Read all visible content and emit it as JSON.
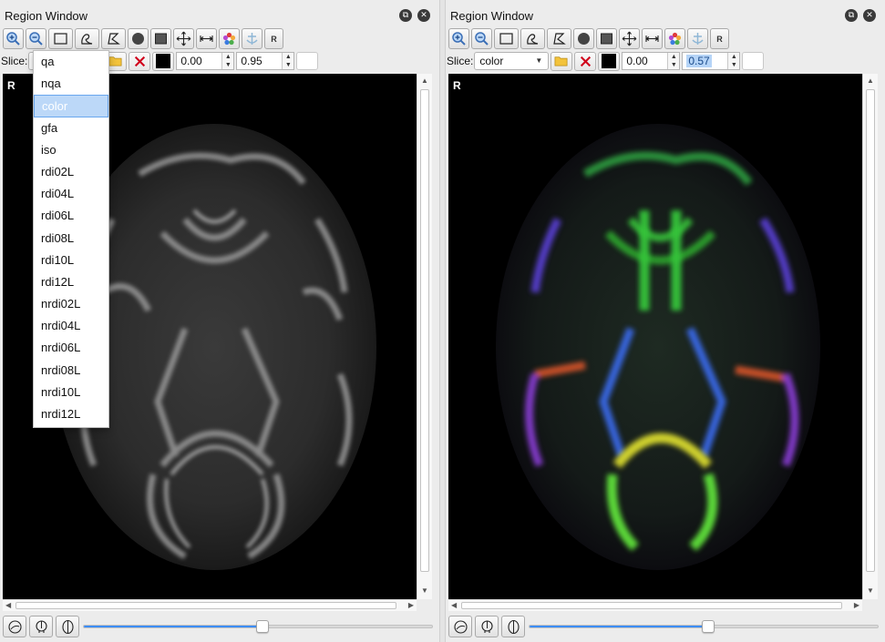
{
  "left": {
    "title": "Region Window",
    "slice_label": "Slice:",
    "min_value": "0.00",
    "max_value": "0.95",
    "orientation_label": "R",
    "slider_position": 0.51,
    "dropdown": {
      "items": [
        "qa",
        "nqa",
        "color",
        "gfa",
        "iso",
        "rdi02L",
        "rdi04L",
        "rdi06L",
        "rdi08L",
        "rdi10L",
        "rdi12L",
        "nrdi02L",
        "nrdi04L",
        "nrdi06L",
        "nrdi08L",
        "nrdi10L",
        "nrdi12L"
      ],
      "highlighted": "color"
    }
  },
  "right": {
    "title": "Region Window",
    "slice_label": "Slice:",
    "slice_value": "color",
    "min_value": "0.00",
    "max_value": "0.57",
    "orientation_label": "R",
    "slider_position": 0.51
  },
  "toolbar_icons": [
    "zoom-in-icon",
    "zoom-out-icon",
    "rectangle-icon",
    "freehand-icon",
    "polygon-icon",
    "circle-icon",
    "square-icon",
    "move-icon",
    "ruler-icon",
    "color-wheel-icon",
    "anchor-icon",
    "r-button"
  ],
  "toolbar_r_text": "R",
  "colors": {
    "accent": "#3d8df5",
    "highlight": "#bcd8f8",
    "delete_red": "#d0021b",
    "folder_yellow": "#f3c33b"
  }
}
